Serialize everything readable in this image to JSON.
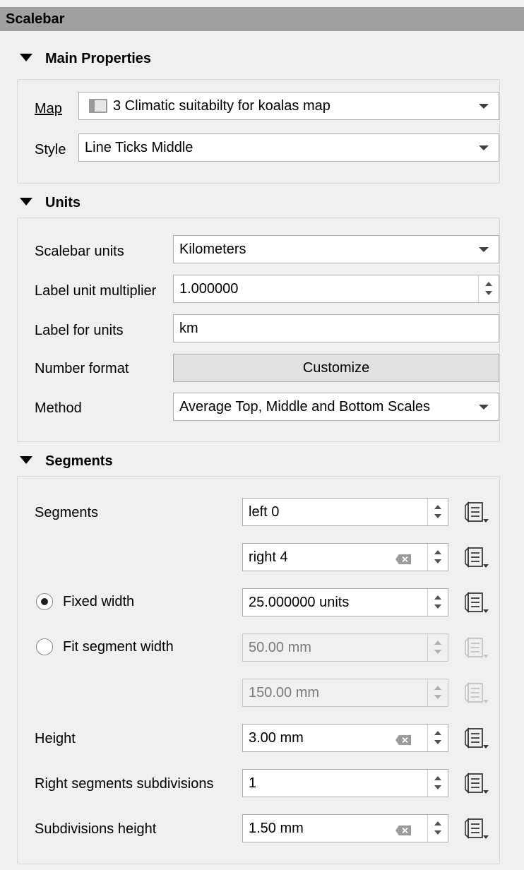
{
  "panel": {
    "title": "Scalebar"
  },
  "main_properties": {
    "header": "Main Properties",
    "map_label": "Map",
    "map_value": "3 Climatic suitabilty for koalas map",
    "style_label": "Style",
    "style_value": "Line Ticks Middle"
  },
  "units": {
    "header": "Units",
    "scalebar_units_label": "Scalebar units",
    "scalebar_units_value": "Kilometers",
    "label_unit_multiplier_label": "Label unit multiplier",
    "label_unit_multiplier_value": "1.000000",
    "label_for_units_label": "Label for units",
    "label_for_units_value": "km",
    "number_format_label": "Number format",
    "number_format_button": "Customize",
    "method_label": "Method",
    "method_value": "Average Top, Middle and Bottom Scales"
  },
  "segments": {
    "header": "Segments",
    "segments_label": "Segments",
    "left_value": "left 0",
    "right_value": "right 4",
    "fixed_width_label": "Fixed width",
    "fixed_width_value": "25.000000 units",
    "fit_segment_width_label": "Fit segment width",
    "fit_min_value": "50.00 mm",
    "fit_max_value": "150.00 mm",
    "height_label": "Height",
    "height_value": "3.00 mm",
    "right_subdivisions_label": "Right segments subdivisions",
    "right_subdivisions_value": "1",
    "subdivisions_height_label": "Subdivisions height",
    "subdivisions_height_value": "1.50 mm",
    "fixed_width_selected": true
  },
  "icons": {
    "map_item": "map-item-icon",
    "data_defined": "data-defined-override-icon",
    "clear": "clear-field-icon",
    "collapse": "collapse-triangle-icon"
  }
}
